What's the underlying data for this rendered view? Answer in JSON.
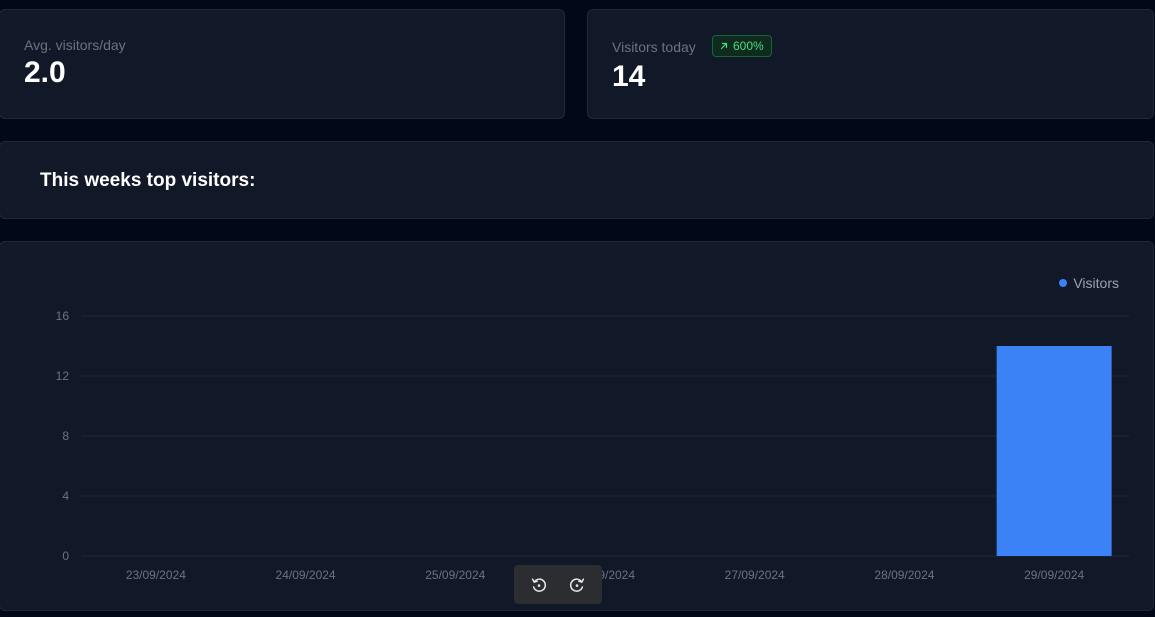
{
  "stats": {
    "avg": {
      "label": "Avg. visitors/day",
      "value": "2.0"
    },
    "today": {
      "label": "Visitors today",
      "value": "14",
      "badge": "600%",
      "badge_icon": "arrow-up-right-icon"
    }
  },
  "top_visitors": {
    "title": "This weeks top visitors:"
  },
  "colors": {
    "accent": "#3b82f6",
    "badge_text": "#4ade80",
    "background": "#020817",
    "card": "#111827"
  },
  "toolbar": {
    "icons": [
      "rotate-left-icon",
      "rotate-right-icon"
    ]
  },
  "chart_data": {
    "type": "bar",
    "categories": [
      "23/09/2024",
      "24/09/2024",
      "25/09/2024",
      "26/09/2024",
      "27/09/2024",
      "28/09/2024",
      "29/09/2024"
    ],
    "series": [
      {
        "name": "Visitors",
        "values": [
          0,
          0,
          0,
          0,
          0,
          0,
          14
        ],
        "color": "#3b82f6"
      }
    ],
    "yticks": [
      0,
      4,
      8,
      12,
      16
    ],
    "ylim": [
      0,
      16
    ],
    "grid": true,
    "legend": "top-right"
  }
}
